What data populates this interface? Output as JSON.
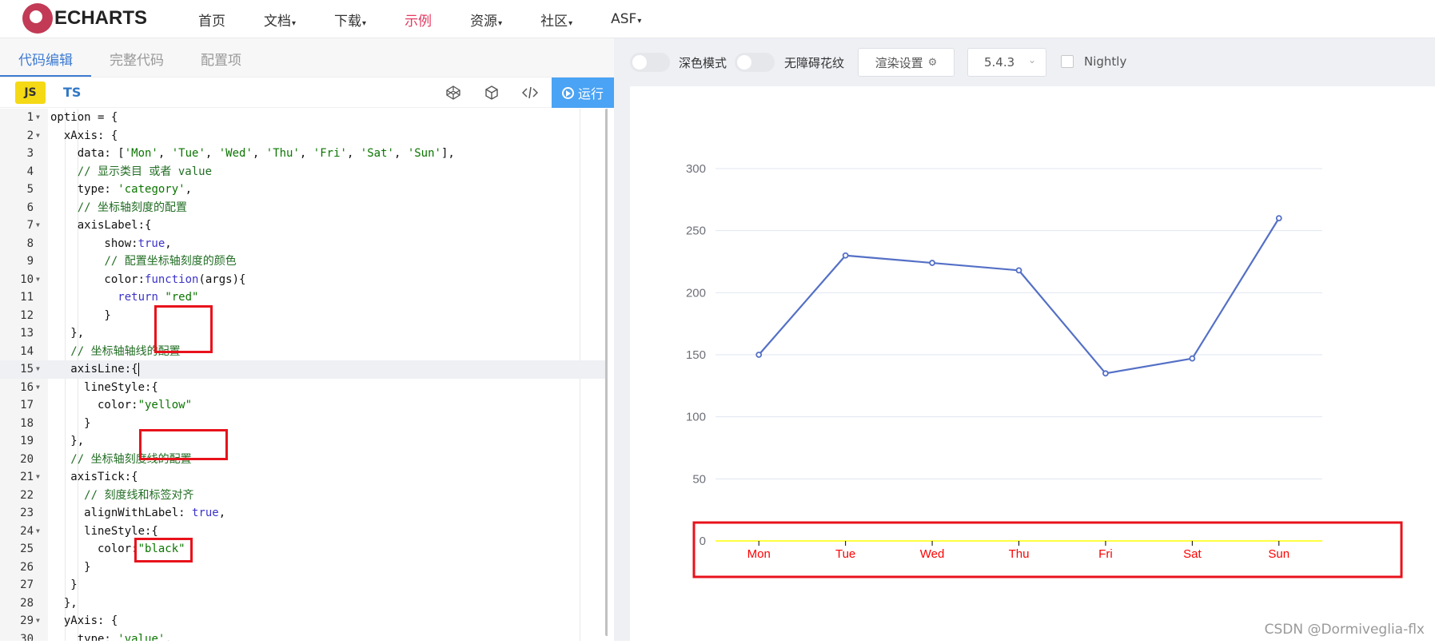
{
  "brand": "ECHARTS",
  "nav": [
    {
      "label": "首页"
    },
    {
      "label": "文档",
      "caret": "▾"
    },
    {
      "label": "下载",
      "caret": "▾"
    },
    {
      "label": "示例"
    },
    {
      "label": "资源",
      "caret": "▾"
    },
    {
      "label": "社区",
      "caret": "▾"
    },
    {
      "label": "ASF",
      "caret": "▾"
    }
  ],
  "editor_tabs": [
    "代码编辑",
    "完整代码",
    "配置项"
  ],
  "lang": {
    "js": "JS",
    "ts": "TS"
  },
  "run_label": "运行",
  "toolbar_icons": [
    "codepen-icon",
    "codesandbox-icon",
    "code-icon"
  ],
  "code_lines": [
    "option = {",
    "  xAxis: {",
    "    data: ['Mon', 'Tue', 'Wed', 'Thu', 'Fri', 'Sat', 'Sun'],",
    "    // 显示类目 或者 value",
    "    type: 'category',",
    "    // 坐标轴刻度的配置",
    "    axisLabel:{",
    "        show:true,",
    "        // 配置坐标轴刻度的颜色",
    "        color:function(args){",
    "          return \"red\"",
    "        }",
    "   },",
    "   // 坐标轴轴线的配置",
    "   axisLine:{",
    "     lineStyle:{",
    "       color:\"yellow\"",
    "     }",
    "   },",
    "   // 坐标轴刻度线的配置",
    "   axisTick:{",
    "     // 刻度线和标签对齐",
    "     alignWithLabel: true,",
    "     lineStyle:{",
    "       color:\"black\"",
    "     }",
    "   }",
    "  },",
    "  yAxis: {",
    "    type: 'value',"
  ],
  "preview_bar": {
    "dark_mode": "深色模式",
    "accessibility": "无障碍花纹",
    "render_settings": "渲染设置",
    "version": "5.4.3",
    "nightly": "Nightly"
  },
  "chart_data": {
    "type": "line",
    "categories": [
      "Mon",
      "Tue",
      "Wed",
      "Thu",
      "Fri",
      "Sat",
      "Sun"
    ],
    "values": [
      150,
      230,
      224,
      218,
      135,
      147,
      260
    ],
    "yticks": [
      0,
      50,
      100,
      150,
      200,
      250,
      300
    ],
    "ylim": [
      0,
      300
    ],
    "series_color": "#5470c6",
    "axis_label_color": "#ff0000",
    "axis_line_color": "#ffff00",
    "axis_tick_color": "#000000",
    "grid": true
  },
  "watermark": "CSDN @Dormiveglia-flx"
}
